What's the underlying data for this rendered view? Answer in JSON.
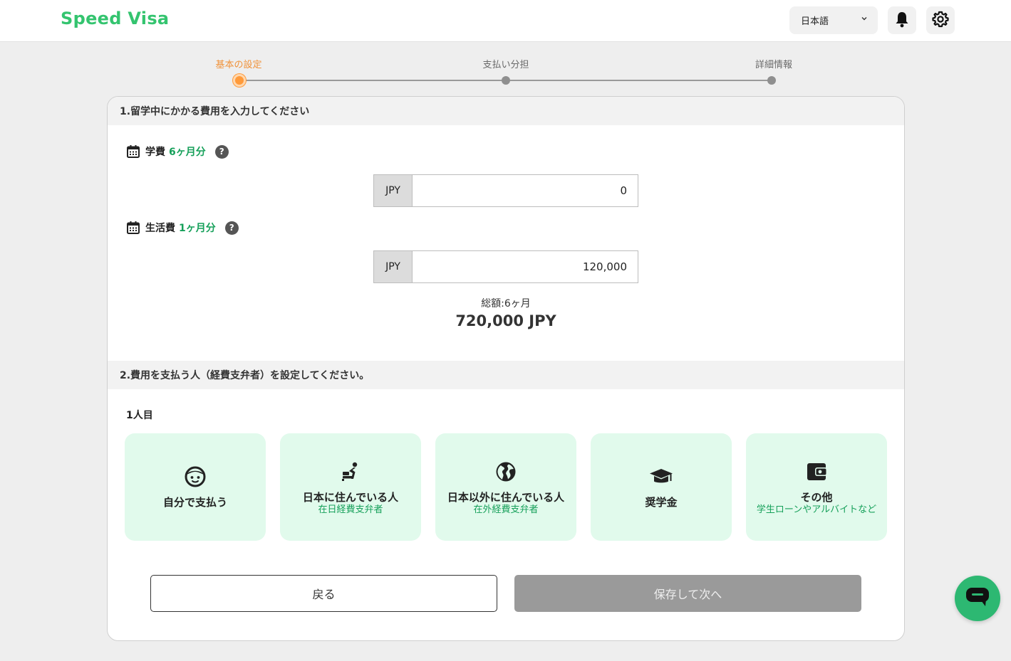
{
  "header": {
    "brand": "Speed Visa",
    "language": "日本語",
    "icons": [
      "chevron-down-icon",
      "bell-icon",
      "gear-icon"
    ]
  },
  "stepper": {
    "steps": [
      {
        "label": "基本の設定",
        "active": true
      },
      {
        "label": "支払い分担",
        "active": false
      },
      {
        "label": "詳細情報",
        "active": false
      }
    ]
  },
  "section1": {
    "title": "1.留学中にかかる費用を入力してください",
    "tuition": {
      "label": "学費",
      "period": "6ヶ月分",
      "currency": "JPY",
      "value": "0",
      "icons": [
        "calendar-icon",
        "help-icon"
      ]
    },
    "living": {
      "label": "生活費",
      "period": "1ヶ月分",
      "currency": "JPY",
      "value": "120,000",
      "icons": [
        "calendar-icon",
        "help-icon"
      ]
    },
    "total": {
      "label": "総額:6ヶ月",
      "amount": "720,000 JPY"
    }
  },
  "section2": {
    "title": "2.費用を支払う人（経費支弁者）を設定してください。",
    "person_label": "1人目",
    "options": [
      {
        "title": "自分で支払う",
        "subtitle": "",
        "icon": "face-icon"
      },
      {
        "title": "日本に住んでいる人",
        "subtitle": "在日経費支弁者",
        "icon": "person-seated-icon"
      },
      {
        "title": "日本以外に住んでいる人",
        "subtitle": "在外経費支弁者",
        "icon": "globe-icon"
      },
      {
        "title": "奨学金",
        "subtitle": "",
        "icon": "graduation-cap-icon"
      },
      {
        "title": "その他",
        "subtitle": "学生ローンやアルバイトなど",
        "icon": "wallet-icon"
      }
    ]
  },
  "buttons": {
    "back": "戻る",
    "next": "保存して次へ"
  },
  "colors": {
    "brand": "#34c46f",
    "accent_orange": "#f0923a",
    "option_bg": "#e1faec",
    "green_text": "#16a05a",
    "disabled_button": "#9a9a9a"
  },
  "chat": {
    "icon": "chat-bubble-icon"
  }
}
